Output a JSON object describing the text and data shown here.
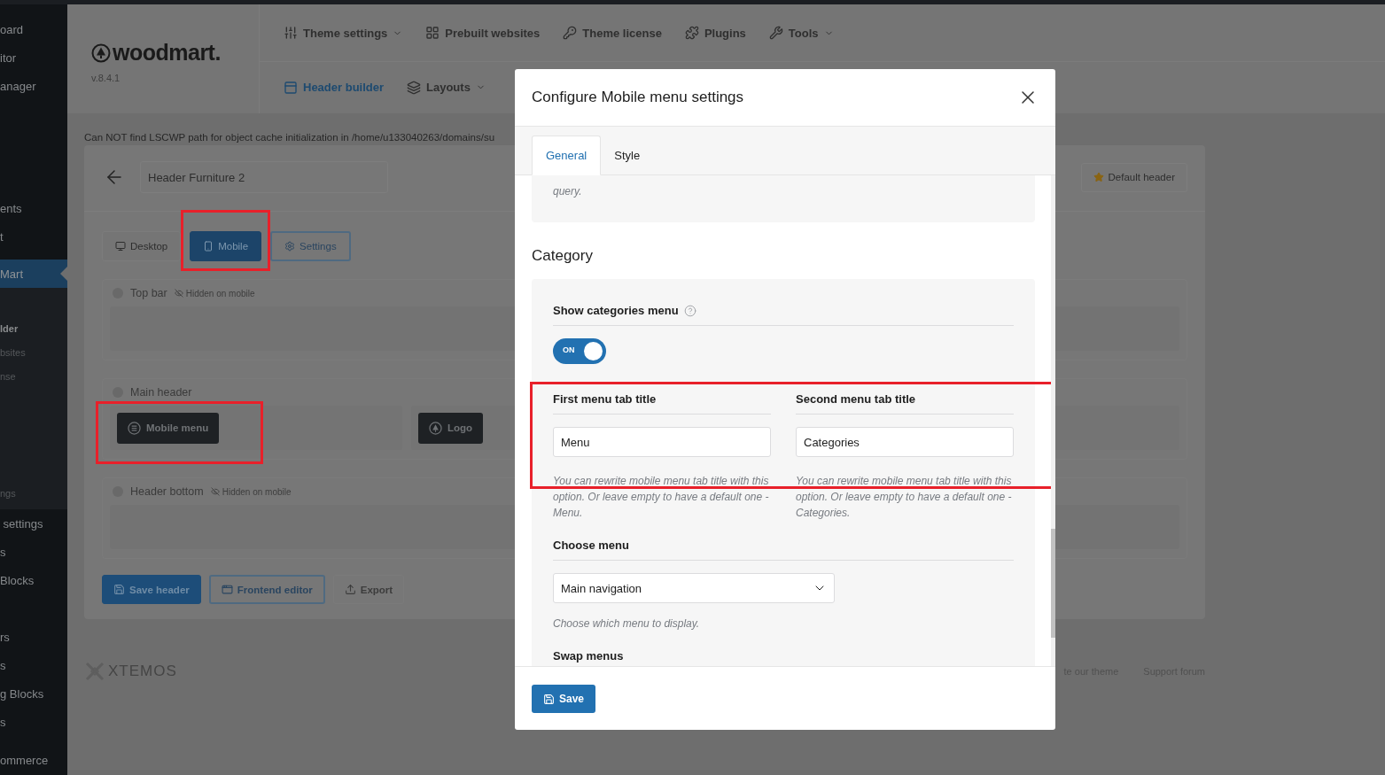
{
  "sidebar": {
    "groups": [
      {
        "kind": "main",
        "items": [
          {
            "label": "oard",
            "selected": false
          },
          {
            "label": "itor",
            "selected": false
          },
          {
            "label": "anager",
            "selected": false
          }
        ]
      },
      {
        "kind": "main",
        "items": [
          {
            "label": "ents",
            "selected": false
          },
          {
            "label": "t",
            "selected": false
          }
        ]
      },
      {
        "kind": "main",
        "items": [
          {
            "label": "Mart",
            "selected": true
          }
        ]
      },
      {
        "kind": "submenu",
        "items": [
          {
            "label": "lder",
            "selected": true
          },
          {
            "label": "bsites",
            "selected": false
          },
          {
            "label": "nse",
            "selected": false
          },
          {
            "label": "ngs",
            "selected": false
          }
        ]
      },
      {
        "kind": "main",
        "items": [
          {
            "label": " settings",
            "selected": false
          },
          {
            "label": "s",
            "selected": false
          },
          {
            "label": "Blocks",
            "selected": false
          }
        ]
      },
      {
        "kind": "main",
        "items": [
          {
            "label": "rs",
            "selected": false
          },
          {
            "label": "s",
            "selected": false
          },
          {
            "label": "g Blocks",
            "selected": false
          },
          {
            "label": "s",
            "selected": false
          }
        ]
      },
      {
        "kind": "main",
        "items": [
          {
            "label": "ommerce",
            "selected": false
          }
        ]
      }
    ]
  },
  "brand": {
    "name": "woodmart.",
    "version": "v.8.4.1"
  },
  "nav": {
    "row1": [
      {
        "kind": "sliders",
        "label": "Theme settings",
        "dropdown": true
      },
      {
        "kind": "grid",
        "label": "Prebuilt websites",
        "dropdown": false
      },
      {
        "kind": "key",
        "label": "Theme license",
        "dropdown": false
      },
      {
        "kind": "puzzle",
        "label": "Plugins",
        "dropdown": false
      },
      {
        "kind": "wrench",
        "label": "Tools",
        "dropdown": true
      }
    ],
    "row2": [
      {
        "kind": "panel",
        "label": "Header builder",
        "dropdown": false,
        "selected": true
      },
      {
        "kind": "layers",
        "label": "Layouts",
        "dropdown": true,
        "selected": false
      }
    ]
  },
  "notice": "Can NOT find LSCWP path for object cache initialization in /home/u133040263/domains/su",
  "builder": {
    "header_name": "Header Furniture 2",
    "default_button": "Default header",
    "device_tabs": [
      {
        "kind": "desktop",
        "label": "Desktop",
        "selected": false,
        "highlighted": false
      },
      {
        "kind": "mobile",
        "label": "Mobile",
        "selected": true,
        "highlighted": true
      },
      {
        "kind": "settings",
        "label": "Settings",
        "selected": false,
        "highlighted": false
      }
    ],
    "rows": [
      {
        "title": "Top bar",
        "hidden_note": "Hidden on mobile",
        "elements": []
      },
      {
        "title": "Main header",
        "elements": [
          {
            "kind": "menu",
            "label": "Mobile menu",
            "highlighted": true
          },
          {
            "kind": "logo",
            "label": "Logo",
            "highlighted": false
          }
        ]
      },
      {
        "title": "Header bottom",
        "hidden_note": "Hidden on mobile",
        "elements": []
      }
    ],
    "actions": [
      {
        "kind": "save",
        "label": "Save header"
      },
      {
        "kind": "frontend",
        "label": "Frontend editor"
      },
      {
        "kind": "export",
        "label": "Export"
      }
    ]
  },
  "footer": {
    "brand": "XTEMOS",
    "links": [
      "te our theme",
      "Support forum"
    ]
  },
  "modal": {
    "title": "Configure Mobile menu settings",
    "tabs": [
      {
        "label": "General",
        "selected": true
      },
      {
        "label": "Style",
        "selected": false
      }
    ],
    "top_card_text": "query.",
    "section_title": "Category",
    "settings": [
      {
        "kind": "toggle",
        "label": "Show categories menu",
        "help_icon": true,
        "on": true,
        "toggle_label": "ON"
      },
      {
        "kind": "text_pair",
        "highlighted": true,
        "fields": [
          {
            "label": "First menu tab title",
            "value": "Menu",
            "hint": "You can rewrite mobile menu tab title with this option. Or leave empty to have a default one - Menu."
          },
          {
            "label": "Second menu tab title",
            "value": "Categories",
            "hint": "You can rewrite mobile menu tab title with this option. Or leave empty to have a default one - Categories."
          }
        ]
      },
      {
        "kind": "select",
        "label": "Choose menu",
        "value": "Main navigation",
        "hint": "Choose which menu to display."
      },
      {
        "kind": "heading",
        "label": "Swap menus"
      }
    ],
    "save_label": "Save"
  }
}
